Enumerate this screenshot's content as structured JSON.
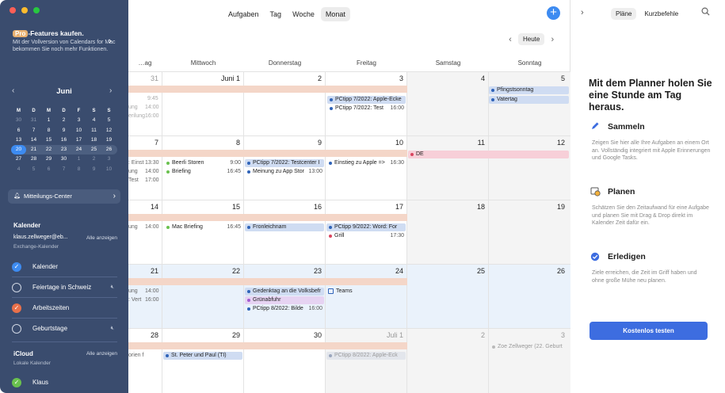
{
  "nav": {
    "tabs": [
      {
        "label": "Aufgaben",
        "active": false
      },
      {
        "label": "Tag",
        "active": false
      },
      {
        "label": "Woche",
        "active": false
      },
      {
        "label": "Monat",
        "active": true
      }
    ],
    "today_label": "Heute",
    "add_symbol": "+"
  },
  "weekdays": [
    "…ag",
    "Mittwoch",
    "Donnerstag",
    "Freitag",
    "Samstag",
    "Sonntag"
  ],
  "weeks": [
    {
      "days": [
        "31",
        "Juni 1",
        "2",
        "3",
        "4",
        "5"
      ]
    },
    {
      "days": [
        "7",
        "8",
        "9",
        "10",
        "11",
        "12"
      ]
    },
    {
      "days": [
        "14",
        "15",
        "16",
        "17",
        "18",
        "19"
      ]
    },
    {
      "days": [
        "21",
        "22",
        "23",
        "24",
        "25",
        "26"
      ]
    },
    {
      "days": [
        "28",
        "29",
        "30",
        "Juli 1",
        "2",
        "3"
      ]
    }
  ],
  "events": {
    "w1_fri_1": {
      "title": "PCtipp 7/2022: Apple-Ecke"
    },
    "w1_fri_2": {
      "title": "PCtipp 7/2022: Test",
      "time": "16:00"
    },
    "w1_sun_1": {
      "title": "Pfingstsonntag"
    },
    "w1_sun_2": {
      "title": "Vatertag"
    },
    "w1_tue_1": {
      "title": "ung",
      "time": "14:00"
    },
    "w1_tue_0": {
      "time": "9:45"
    },
    "w1_tue_2": {
      "title": "erilung",
      "time": "16:00"
    },
    "w2_wed_1": {
      "title": "Beerli Storen",
      "time": "9:00"
    },
    "w2_wed_2": {
      "title": "Briefing",
      "time": "16:45"
    },
    "w2_thu_1": {
      "title": "PCtipp 7/2022: Testcenter I"
    },
    "w2_thu_2": {
      "title": "Meinung zu App Stor",
      "time": "13:00"
    },
    "w2_fri_1": {
      "title": "Einstieg zu Apple =>",
      "time": "16:30"
    },
    "w2_sat_1": {
      "title": "DE"
    },
    "w2_tue_1": {
      "title": ": Einst",
      "time": "13:30"
    },
    "w2_tue_2": {
      "title": "ung",
      "time": "14:00"
    },
    "w2_tue_3": {
      "title": "Test",
      "time": "17:00"
    },
    "w3_tue_1": {
      "title": "ung",
      "time": "14:00"
    },
    "w3_wed_1": {
      "title": "Mac Briefing",
      "time": "16:45"
    },
    "w3_thu_1": {
      "title": "Fronleichnam"
    },
    "w3_fri_1": {
      "title": "PCtipp 9/2022: Word: For"
    },
    "w3_fri_2": {
      "title": "Grill",
      "time": "17:30"
    },
    "w4_tue_1": {
      "title": ": Vert",
      "time": "16:00"
    },
    "w4_tue_2": {
      "title": "ung",
      "time": "14:00"
    },
    "w4_thu_1": {
      "title": "Gedenktag an die Volksbefr"
    },
    "w4_thu_2": {
      "title": "Grünabfuhr"
    },
    "w4_thu_3": {
      "title": "PCtipp 8/2022: Bilde",
      "time": "16:00"
    },
    "w4_fri_1": {
      "title": "Teams"
    },
    "w5_tue_1": {
      "title": "orien f"
    },
    "w5_wed_1": {
      "title": "St. Peter und Paul (TI)"
    },
    "w5_fri_1": {
      "title": "PCtipp 8/2022: Apple-Eck"
    },
    "w5_sun_1": {
      "title": "Zoe Zellweger (22. Geburt"
    }
  },
  "sidebar": {
    "pro_badge": "Pro",
    "pro_title": "-Features kaufen.",
    "pro_desc": "Mit der Vollversion von Calendars for Mac bekommen Sie noch mehr Funktionen.",
    "mini": {
      "month": "Juni",
      "headers": [
        "M",
        "D",
        "M",
        "D",
        "F",
        "S",
        "S"
      ],
      "rows": [
        [
          "30",
          "31",
          "1",
          "2",
          "3",
          "4",
          "5"
        ],
        [
          "6",
          "7",
          "8",
          "9",
          "10",
          "11",
          "12"
        ],
        [
          "13",
          "14",
          "15",
          "16",
          "17",
          "18",
          "19"
        ],
        [
          "20",
          "21",
          "22",
          "23",
          "24",
          "25",
          "26"
        ],
        [
          "27",
          "28",
          "29",
          "30",
          "1",
          "2",
          "3"
        ],
        [
          "4",
          "5",
          "6",
          "7",
          "8",
          "9",
          "10"
        ]
      ]
    },
    "notif_label": "Mitteilungs-Center",
    "kalender_title": "Kalender",
    "account": "klaus.zellweger@eb...",
    "account_sub": "Exchange-Kalender",
    "show_all": "Alle anzeigen",
    "calendars": [
      {
        "name": "Kalender",
        "checked": true,
        "color": "#3d8bf1"
      },
      {
        "name": "Feiertage in Schweiz",
        "checked": false,
        "color": ""
      },
      {
        "name": "Arbeitszeiten",
        "checked": true,
        "color": "#e8704a"
      },
      {
        "name": "Geburtstage",
        "checked": false,
        "color": ""
      }
    ],
    "icloud_title": "iCloud",
    "icloud_sub": "Lokale Kalender",
    "icloud_show_all": "Alle anzeigen",
    "icloud_cal": {
      "name": "Klaus",
      "checked": true,
      "color": "#6ac14e"
    }
  },
  "panel": {
    "tabs": [
      {
        "label": "Pläne",
        "active": true
      },
      {
        "label": "Kurzbefehle",
        "active": false
      }
    ],
    "headline": "Mit dem Planner holen Sie eine Stunde am Tag heraus.",
    "features": [
      {
        "icon": "pencil-icon",
        "title": "Sammeln",
        "desc": "Zeigen Sie hier alle Ihre Aufgaben an einem Ort an. Vollständig integriert mit Apple Erinnerungen und Google Tasks."
      },
      {
        "icon": "calendar-clock-icon",
        "title": "Planen",
        "desc": "Schätzen Sie den Zeitaufwand für eine Aufgabe und planen Sie mit Drag & Drop direkt im Kalender Zeit dafür ein."
      },
      {
        "icon": "check-circle-icon",
        "title": "Erledigen",
        "desc": "Ziele erreichen, die Zeit im Griff haben und ohne große Mühe neu planen."
      }
    ],
    "cta": "Kostenlos testen"
  },
  "colors": {
    "accent": "#3d8bf1",
    "sidebar_bg": "#3a4c6e",
    "band": "#f4d6c8",
    "event_blue": "#cfdcf2",
    "event_pink": "#f7cfd8",
    "event_purple": "#e6d3f2"
  }
}
